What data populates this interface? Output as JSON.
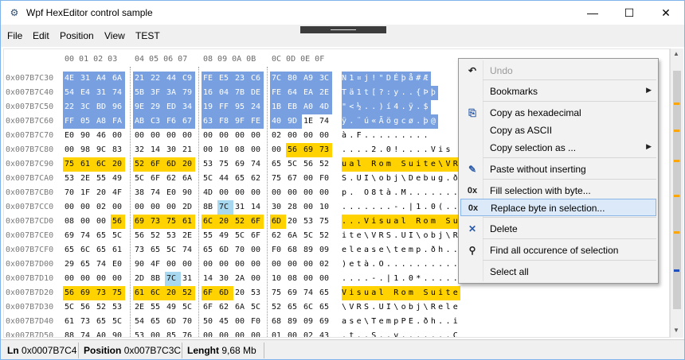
{
  "window": {
    "title": "Wpf HexEditor control sample",
    "controls": [
      "minimize",
      "maximize",
      "close"
    ]
  },
  "menu": [
    "File",
    "Edit",
    "Position",
    "View",
    "TEST"
  ],
  "hex_header": [
    "00 01 02 03",
    "04 05 06 07",
    "08 09 0A 0B",
    "0C 0D 0E 0F"
  ],
  "rows": [
    {
      "addr": "0x007B7C30",
      "g": [
        "4E 31 A4 6A",
        "21 22 44 C9",
        "FE E5 23 C6",
        "7C 80 A9 3C"
      ],
      "ascii": "N1¤j!\"DÉþå#Æ"
    },
    {
      "addr": "0x007B7C40",
      "g": [
        "54 E4 31 74",
        "5B 3F 3A 79",
        "16 04 7B DE",
        "FE 64 EA 2E"
      ],
      "ascii": "Tä1t[?:y..{Þþ"
    },
    {
      "addr": "0x007B7C50",
      "g": [
        "22 3C BD 96",
        "9E 29 ED 34",
        "19 FF 95 24",
        "1B EB A0 4D"
      ],
      "ascii": "\"<½..)í4.ÿ.$"
    },
    {
      "addr": "0x007B7C60",
      "g": [
        "FF 05 A8 FA",
        "AB C3 F6 67",
        "63 F8 9F FE",
        "40 9D 1E 74"
      ],
      "ascii": "ÿ.¨ú«Ãögcø.þ@"
    },
    {
      "addr": "0x007B7C70",
      "g": [
        "E0 90 46 00",
        "00 00 00 00",
        "00 00 00 00",
        "02 00 00 00"
      ],
      "ascii": "à.F........."
    },
    {
      "addr": "0x007B7C80",
      "g": [
        "00 98 9C 83",
        "32 14 30 21",
        "00 10 08 00",
        "00 56 69 73"
      ],
      "ascii": "....2.0!....Vis"
    },
    {
      "addr": "0x007B7C90",
      "g": [
        "75 61 6C 20",
        "52 6F 6D 20",
        "53 75 69 74",
        "65 5C 56 52"
      ],
      "ascii": "ual Rom Suite\\VR"
    },
    {
      "addr": "0x007B7CA0",
      "g": [
        "53 2E 55 49",
        "5C 6F 62 6A",
        "5C 44 65 62",
        "75 67 00 F0"
      ],
      "ascii": "S.UI\\obj\\Debug.ð"
    },
    {
      "addr": "0x007B7CB0",
      "g": [
        "70 1F 20 4F",
        "38 74 E0 90",
        "4D 00 00 00",
        "00 00 00 00"
      ],
      "ascii": "p. O8tà.M......."
    },
    {
      "addr": "0x007B7CC0",
      "g": [
        "00 00 02 00",
        "00 00 00 2D",
        "8B 7C 31 14",
        "30 28 00 10"
      ],
      "ascii": ".......-.|1.0(.."
    },
    {
      "addr": "0x007B7CD0",
      "g": [
        "08 00 00 56",
        "69 73 75 61",
        "6C 20 52 6F",
        "6D 20 53 75"
      ],
      "ascii": "...Visual Rom Su"
    },
    {
      "addr": "0x007B7CE0",
      "g": [
        "69 74 65 5C",
        "56 52 53 2E",
        "55 49 5C 6F",
        "62 6A 5C 52"
      ],
      "ascii": "ite\\VRS.UI\\obj\\R"
    },
    {
      "addr": "0x007B7CF0",
      "g": [
        "65 6C 65 61",
        "73 65 5C 74",
        "65 6D 70 00",
        "F0 68 89 09"
      ],
      "ascii": "elease\\temp.ðh.."
    },
    {
      "addr": "0x007B7D00",
      "g": [
        "29 65 74 E0",
        "90 4F 00 00",
        "00 00 00 00",
        "00 00 00 02"
      ],
      "ascii": ")età.O.........."
    },
    {
      "addr": "0x007B7D10",
      "g": [
        "00 00 00 00",
        "2D 8B 7C 31",
        "14 30 2A 00",
        "10 08 00 00"
      ],
      "ascii": "....-.|1.0*....."
    },
    {
      "addr": "0x007B7D20",
      "g": [
        "56 69 73 75",
        "61 6C 20 52",
        "6F 6D 20 53",
        "75 69 74 65"
      ],
      "ascii": "Visual Rom Suite"
    },
    {
      "addr": "0x007B7D30",
      "g": [
        "5C 56 52 53",
        "2E 55 49 5C",
        "6F 62 6A 5C",
        "52 65 6C 65"
      ],
      "ascii": "\\VRS.UI\\obj\\Rele"
    },
    {
      "addr": "0x007B7D40",
      "g": [
        "61 73 65 5C",
        "54 65 6D 70",
        "50 45 00 F0",
        "68 89 09 69"
      ],
      "ascii": "ase\\TempPE.ðh..i"
    },
    {
      "addr": "0x007B7D50",
      "g": [
        "88 74 A0 90",
        "53 00 85 76",
        "00 00 00 00",
        "01 00 02 43"
      ],
      "ascii": ".t..S..v.......C"
    }
  ],
  "context_menu": {
    "items": [
      {
        "icon": "undo-icon",
        "glyph": "↶",
        "label": "Undo",
        "disabled": true
      },
      {
        "icon": "",
        "glyph": "",
        "label": "Bookmarks",
        "submenu": true
      },
      {
        "icon": "copy-icon",
        "glyph": "⎘",
        "label": "Copy as hexadecimal"
      },
      {
        "icon": "",
        "glyph": "",
        "label": "Copy as ASCII"
      },
      {
        "icon": "",
        "glyph": "",
        "label": "Copy selection as ...",
        "submenu": true
      },
      {
        "icon": "paste-brush-icon",
        "glyph": "✎",
        "label": "Paste without inserting"
      },
      {
        "icon": "fill-0x-icon",
        "glyph": "0x",
        "label": "Fill selection with byte..."
      },
      {
        "icon": "replace-0x-icon",
        "glyph": "0x",
        "label": "Replace byte in selection...",
        "hover": true
      },
      {
        "icon": "delete-icon",
        "glyph": "✕",
        "label": "Delete"
      },
      {
        "icon": "find-icon",
        "glyph": "⚲",
        "label": "Find all occurence of selection"
      },
      {
        "icon": "",
        "glyph": "",
        "label": "Select all"
      }
    ]
  },
  "status": {
    "ln_label": "Ln",
    "ln_value": "0x0007B7C4",
    "pos_label": "Position",
    "pos_value": "0x007B7C3C",
    "len_label": "Lenght",
    "len_value": "9,68 Mb"
  },
  "colors": {
    "selection": "#78a0e0",
    "highlight": "#ffd200",
    "find_match": "#a8d8f0",
    "hover": "#dbe9f8"
  }
}
